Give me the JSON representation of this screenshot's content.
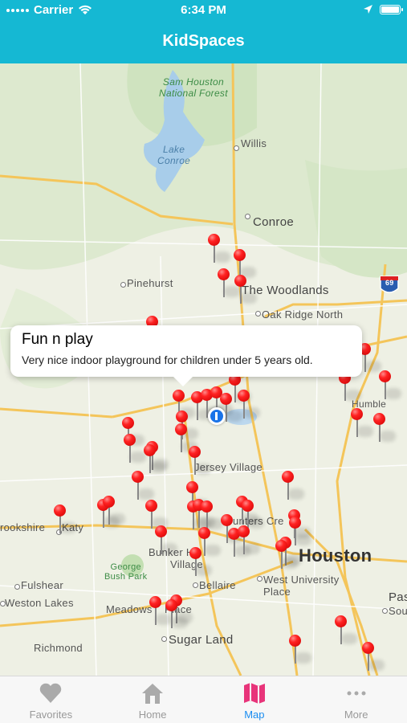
{
  "status": {
    "carrier": "Carrier",
    "time": "6:34 PM"
  },
  "nav": {
    "title": "KidSpaces"
  },
  "map": {
    "labels": {
      "forest": "Sam Houston\nNational Forest",
      "lake": "Lake\nConroe",
      "willis": "Willis",
      "conroe": "Conroe",
      "pinehurst": "Pinehurst",
      "woodlands": "The Woodlands",
      "oakridge": "Oak Ridge North",
      "humble": "Humble",
      "jersey": "Jersey Village",
      "brookshire": "rookshire",
      "katy": "Katy",
      "hunters": "unters Cre",
      "houston": "Houston",
      "bunker": "Bunker H",
      "village": "Village",
      "georgebush": "George\nBush Park",
      "fulshear": "Fulshear",
      "bellaire": "Bellaire",
      "westu": "West University",
      "place": "Place",
      "westonlakes": "Weston Lakes",
      "meadows": "Meadows",
      "place2": "Place",
      "pasadena": "Pas",
      "southhouston": "South H",
      "richmond": "Richmond",
      "sugarland": "Sugar Land",
      "i69": "69"
    }
  },
  "callout": {
    "title": "Fun n play",
    "description": "Very nice indoor playground for children under 5 years old."
  },
  "tabs": [
    {
      "label": "Favorites",
      "icon": "heart-icon"
    },
    {
      "label": "Home",
      "icon": "house-icon"
    },
    {
      "label": "Map",
      "icon": "map-icon"
    },
    {
      "label": "More",
      "icon": "more-dots-icon"
    }
  ],
  "colors": {
    "accent": "#15b8d3",
    "tab_active": "#1a8cf0",
    "pin": "#ee2222"
  }
}
